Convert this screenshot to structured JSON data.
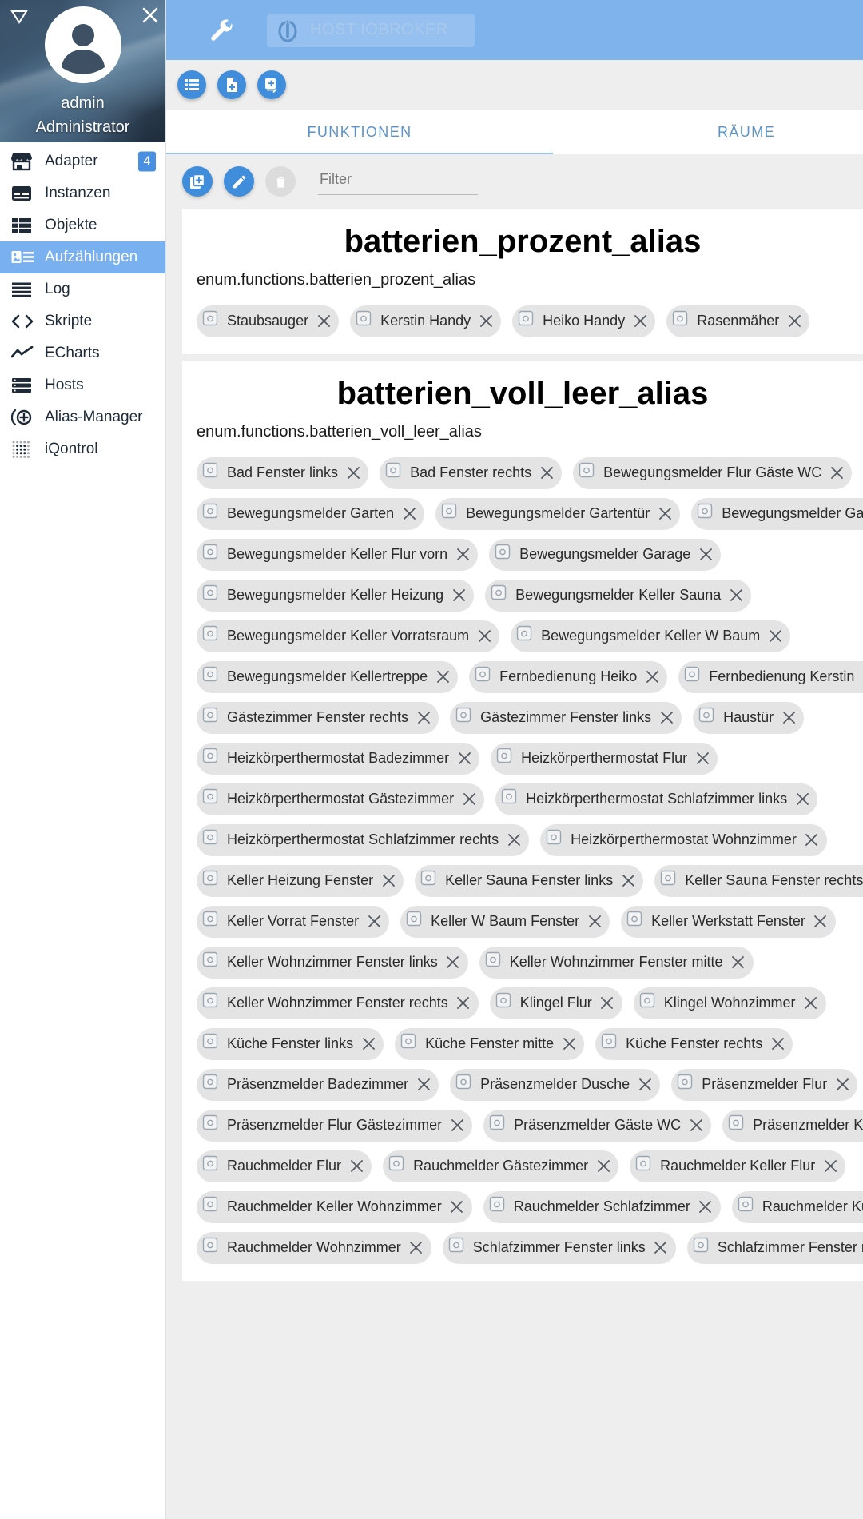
{
  "sidebar": {
    "collapse_icon": "collapse-triangle-icon",
    "user": {
      "name": "admin",
      "role": "Administrator"
    },
    "items": [
      {
        "label": "Adapter",
        "icon": "store-icon",
        "badge": "4",
        "selected": false
      },
      {
        "label": "Instanzen",
        "icon": "instances-icon",
        "badge": "",
        "selected": false
      },
      {
        "label": "Objekte",
        "icon": "objects-icon",
        "badge": "",
        "selected": false
      },
      {
        "label": "Aufzählungen",
        "icon": "enums-icon",
        "badge": "",
        "selected": true
      },
      {
        "label": "Log",
        "icon": "log-icon",
        "badge": "",
        "selected": false
      },
      {
        "label": "Skripte",
        "icon": "code-icon",
        "badge": "",
        "selected": false
      },
      {
        "label": "ECharts",
        "icon": "chart-line-icon",
        "badge": "",
        "selected": false
      },
      {
        "label": "Hosts",
        "icon": "hosts-icon",
        "badge": "",
        "selected": false
      },
      {
        "label": "Alias-Manager",
        "icon": "alias-plus-icon",
        "badge": "",
        "selected": false
      },
      {
        "label": "iQontrol",
        "icon": "dots-grid-icon",
        "badge": "",
        "selected": false
      }
    ]
  },
  "appbar": {
    "settings_icon": "wrench-icon",
    "host_logo_icon": "iobroker-logo-icon",
    "host_label": "HOST IOBROKER",
    "close_icon": "close-icon"
  },
  "iconbar": {
    "buttons": [
      {
        "icon": "list-icon"
      },
      {
        "icon": "file-add-icon"
      },
      {
        "icon": "import-icon"
      }
    ]
  },
  "tabs": [
    {
      "label": "FUNKTIONEN",
      "active": true
    },
    {
      "label": "RÄUME",
      "active": false
    }
  ],
  "toolbar": {
    "add_icon": "add-copy-icon",
    "edit_icon": "pencil-icon",
    "delete_icon": "trash-icon",
    "filter_placeholder": "Filter",
    "filter_value": ""
  },
  "colors": {
    "accent": "#3f8ddb",
    "appbar": "#7eb3ec",
    "selected_nav": "#79b0ef",
    "chip_bg": "#e4e4e4",
    "page_bg": "#eeeeee"
  },
  "cards": [
    {
      "title": "batterien_prozent_alias",
      "subtitle": "enum.functions.batterien_prozent_alias",
      "rows": [
        [
          "Staubsauger",
          "Kerstin Handy",
          "Heiko Handy",
          "Rasenmäher"
        ]
      ]
    },
    {
      "title": "batterien_voll_leer_alias",
      "subtitle": "enum.functions.batterien_voll_leer_alias",
      "rows": [
        [
          "Bad Fenster links",
          "Bad Fenster rechts",
          "Bewegungsmelder Flur Gäste WC"
        ],
        [
          "Bewegungsmelder Garten",
          "Bewegungsmelder Gartentür",
          "Bewegungsmelder Garten Terrasse"
        ],
        [
          "Bewegungsmelder Keller Flur vorn",
          "Bewegungsmelder Garage"
        ],
        [
          "Bewegungsmelder Keller Heizung",
          "Bewegungsmelder Keller Sauna"
        ],
        [
          "Bewegungsmelder Keller Vorratsraum",
          "Bewegungsmelder Keller W Baum"
        ],
        [
          "Bewegungsmelder Kellertreppe",
          "Fernbedienung Heiko",
          "Fernbedienung Kerstin"
        ],
        [
          "Gästezimmer Fenster rechts",
          "Gästezimmer Fenster links",
          "Haustür"
        ],
        [
          "Heizkörperthermostat Badezimmer",
          "Heizkörperthermostat Flur"
        ],
        [
          "Heizkörperthermostat Gästezimmer",
          "Heizkörperthermostat Schlafzimmer links"
        ],
        [
          "Heizkörperthermostat Schlafzimmer rechts",
          "Heizkörperthermostat Wohnzimmer"
        ],
        [
          "Keller Heizung Fenster",
          "Keller Sauna Fenster links",
          "Keller Sauna Fenster rechts"
        ],
        [
          "Keller Vorrat Fenster",
          "Keller W Baum Fenster",
          "Keller Werkstatt Fenster"
        ],
        [
          "Keller Wohnzimmer Fenster links",
          "Keller Wohnzimmer Fenster mitte"
        ],
        [
          "Keller Wohnzimmer Fenster rechts",
          "Klingel Flur",
          "Klingel Wohnzimmer"
        ],
        [
          "Küche Fenster links",
          "Küche Fenster mitte",
          "Küche Fenster rechts"
        ],
        [
          "Präsenzmelder Badezimmer",
          "Präsenzmelder Dusche",
          "Präsenzmelder Flur"
        ],
        [
          "Präsenzmelder Flur Gästezimmer",
          "Präsenzmelder Gäste WC",
          "Präsenzmelder Küche"
        ],
        [
          "Rauchmelder Flur",
          "Rauchmelder Gästezimmer",
          "Rauchmelder Keller Flur"
        ],
        [
          "Rauchmelder Keller Wohnzimmer",
          "Rauchmelder Schlafzimmer",
          "Rauchmelder Küche"
        ],
        [
          "Rauchmelder Wohnzimmer",
          "Schlafzimmer Fenster links",
          "Schlafzimmer Fenster rechts"
        ]
      ]
    }
  ]
}
